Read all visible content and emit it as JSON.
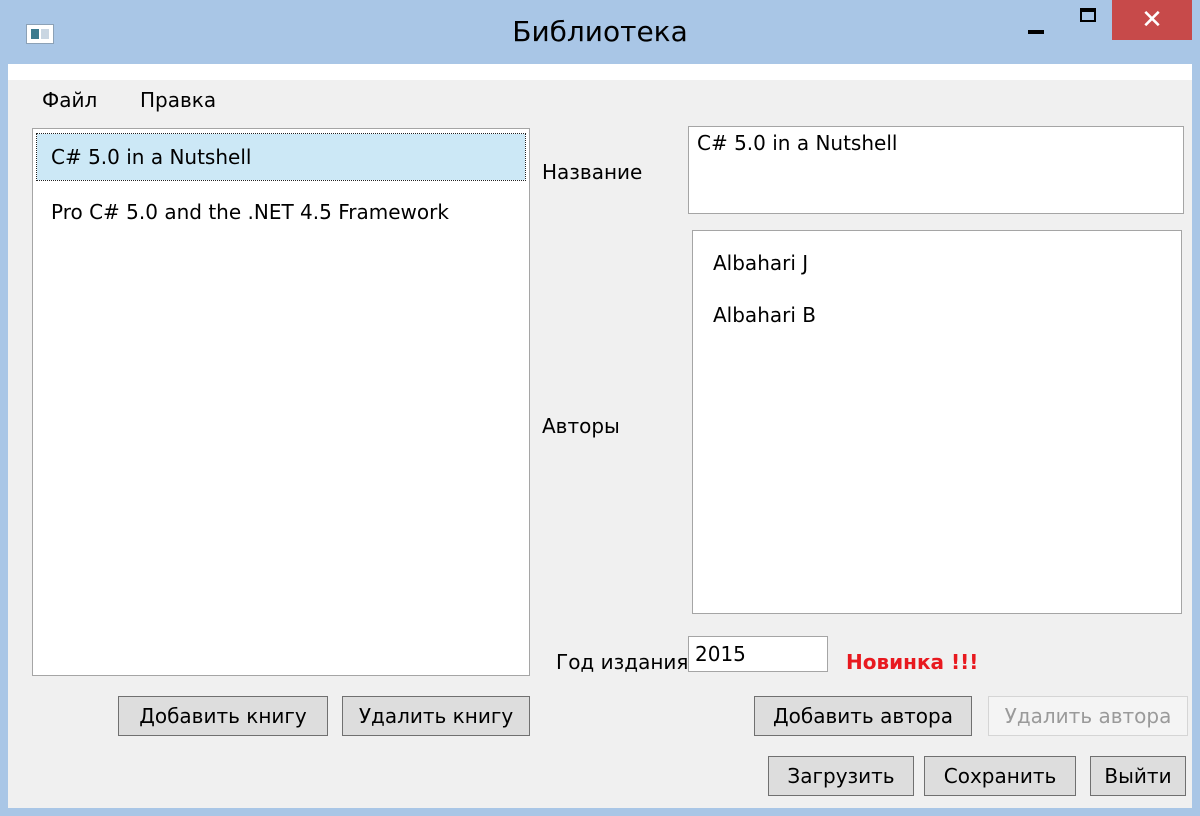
{
  "window": {
    "title": "Библиотека",
    "close_glyph": "✕"
  },
  "menu": {
    "items": [
      "Файл",
      "Правка"
    ]
  },
  "books": [
    {
      "title": "C# 5.0 in a Nutshell",
      "selected": true
    },
    {
      "title": "Pro C# 5.0 and the .NET 4.5 Framework",
      "selected": false
    }
  ],
  "details": {
    "title_label": "Название",
    "title_value": "C# 5.0 in a Nutshell",
    "authors_label": "Авторы",
    "authors": [
      "Albahari J",
      "Albahari B"
    ],
    "year_label": "Год издания",
    "year_value": "2015",
    "new_badge": "Новинка !!!",
    "new_badge_color": "#e8191f"
  },
  "buttons": {
    "add_book": "Добавить книгу",
    "delete_book": "Удалить книгу",
    "add_author": "Добавить автора",
    "delete_author": "Удалить автора",
    "load": "Загрузить",
    "save": "Сохранить",
    "exit": "Выйти"
  },
  "colors": {
    "titlebar": "#a9c6e6",
    "close_button": "#c74a4a",
    "selected_item": "#cce8f6"
  }
}
